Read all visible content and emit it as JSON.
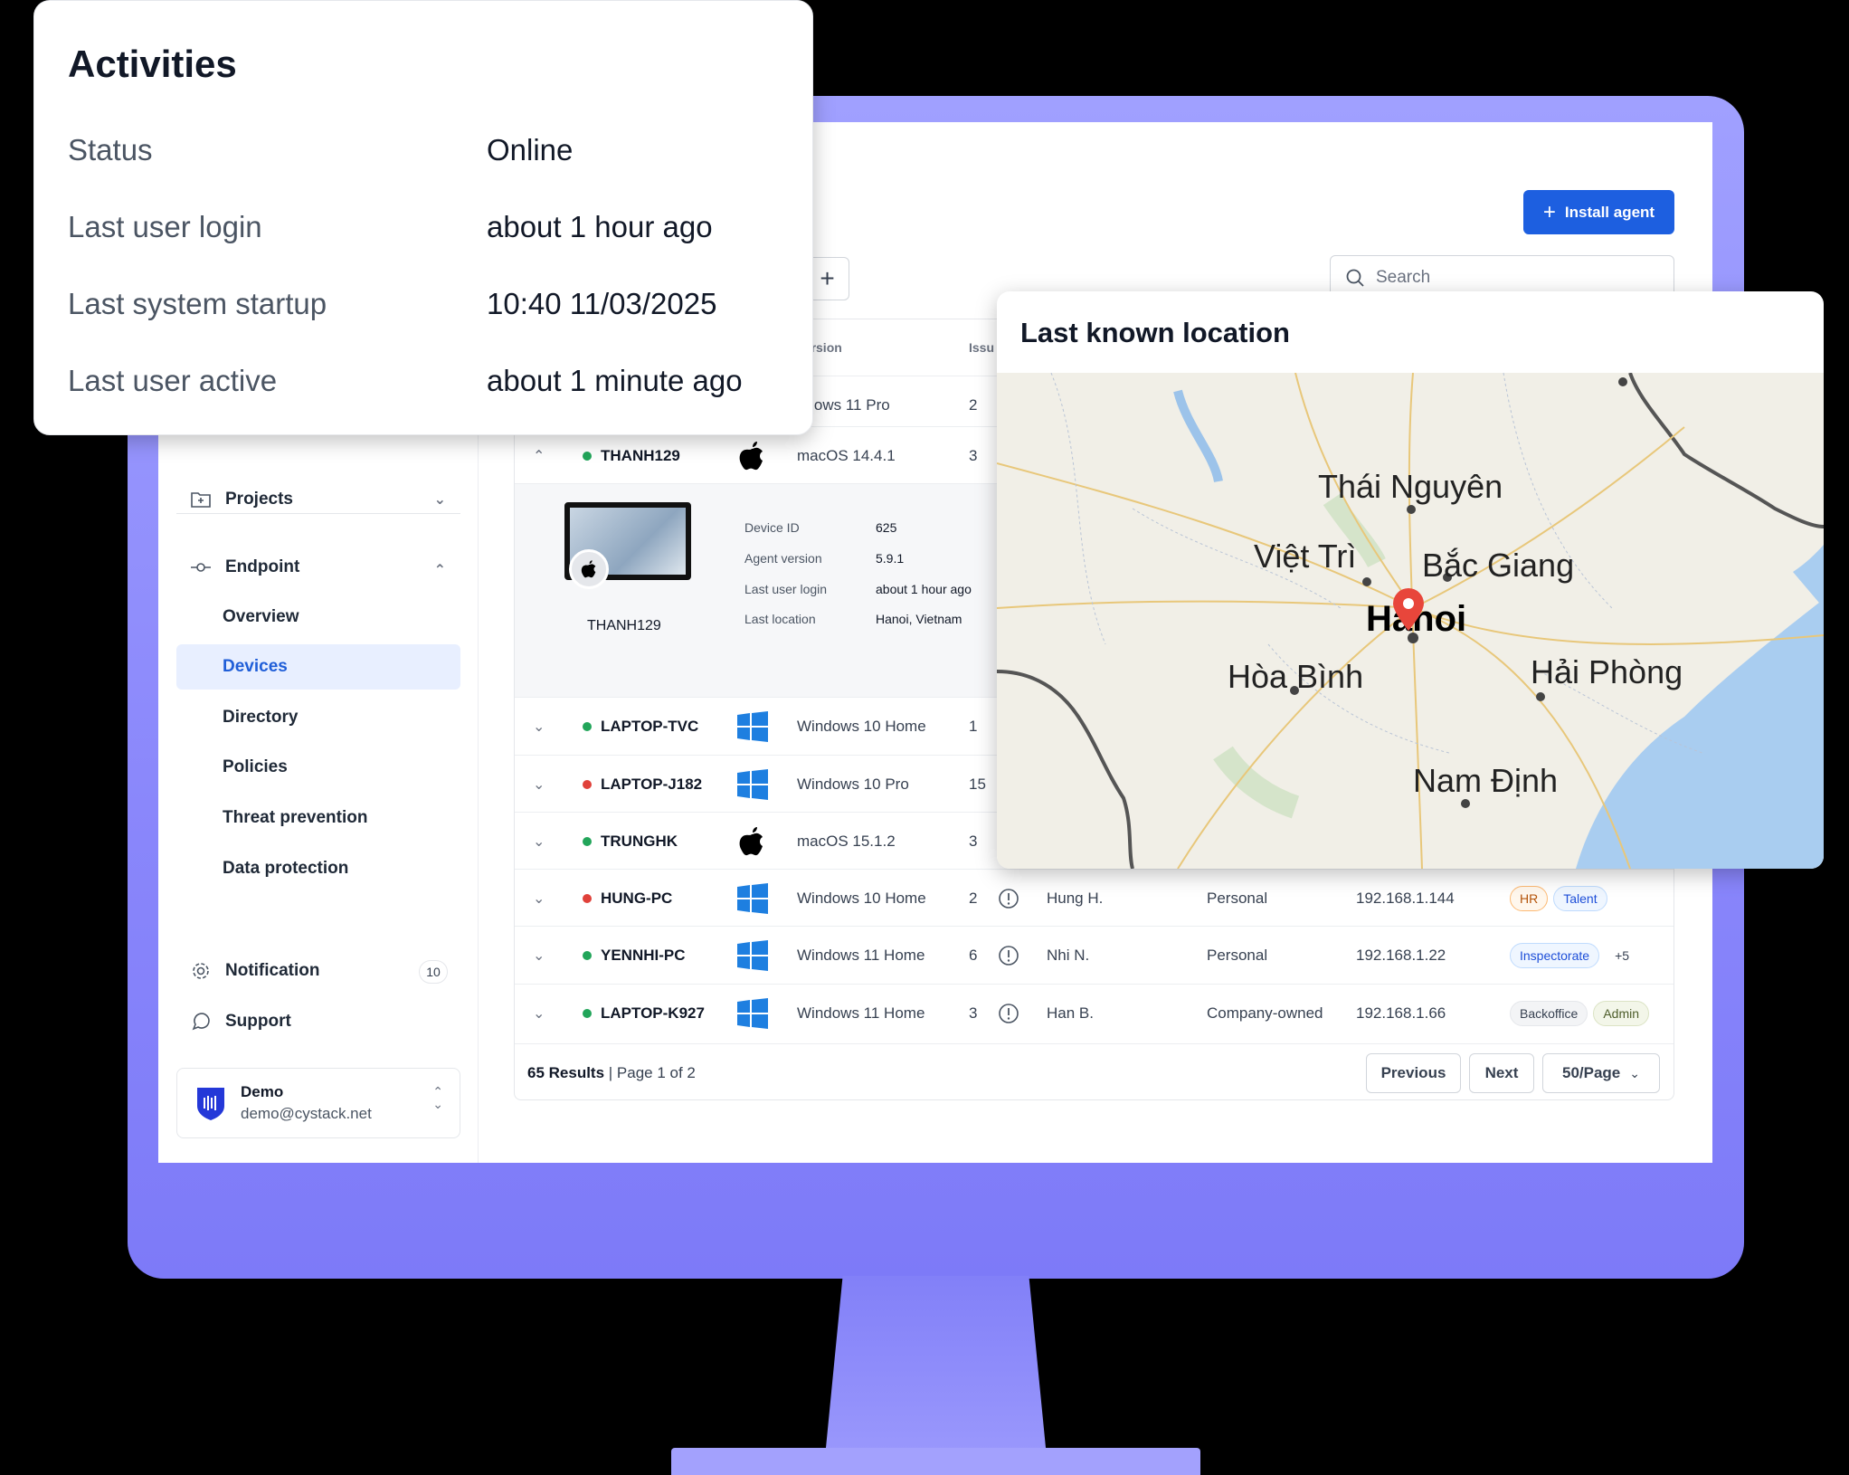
{
  "activities": {
    "title": "Activities",
    "rows": [
      {
        "label": "Status",
        "value": "Online"
      },
      {
        "label": "Last user login",
        "value": "about 1 hour ago"
      },
      {
        "label": "Last system startup",
        "value": "10:40 11/03/2025"
      },
      {
        "label": "Last user active",
        "value": "about 1 minute ago"
      }
    ]
  },
  "location": {
    "title": "Last known location",
    "places": [
      "Thái Nguyên",
      "Việt Trì",
      "Bắc Giang",
      "Hanoi",
      "Hòa Bình",
      "Hải Phòng",
      "Nam Định"
    ]
  },
  "header": {
    "install_label": "Install agent",
    "search_placeholder": "Search"
  },
  "sidebar": {
    "projects": "Projects",
    "endpoint": "Endpoint",
    "sub": [
      "Overview",
      "Devices",
      "Directory",
      "Policies",
      "Threat prevention",
      "Data protection"
    ],
    "notification": "Notification",
    "notification_count": "10",
    "support": "Support",
    "user_name": "Demo",
    "user_email": "demo@cystack.net"
  },
  "table": {
    "col_version": "version",
    "col_issues": "Issu",
    "top_row": {
      "os": "ndows 11 Pro",
      "issues": "2"
    },
    "expanded": {
      "device": "THANH129",
      "os": "macOS 14.4.1",
      "issues": "3",
      "status": "green"
    },
    "detail": {
      "device_caption": "THANH129",
      "fields": [
        {
          "label": "Device ID",
          "value": "625"
        },
        {
          "label": "Agent version",
          "value": "5.9.1"
        },
        {
          "label": "Last user login",
          "value": "about 1 hour ago"
        },
        {
          "label": "Last location",
          "value": "Hanoi, Vietnam"
        }
      ]
    },
    "rows": [
      {
        "device": "LAPTOP-TVC",
        "status": "green",
        "os_icon": "windows",
        "os": "Windows 10 Home",
        "issues": "1"
      },
      {
        "device": "LAPTOP-J182",
        "status": "red",
        "os_icon": "windows",
        "os": "Windows 10 Pro",
        "issues": "15"
      },
      {
        "device": "TRUNGHK",
        "status": "green",
        "os_icon": "apple",
        "os": "macOS 15.1.2",
        "issues": "3"
      },
      {
        "device": "HUNG-PC",
        "status": "red",
        "os_icon": "windows",
        "os": "Windows 10 Home",
        "issues": "2",
        "user": "Hung H.",
        "ownership": "Personal",
        "ip": "192.168.1.144",
        "tags": [
          {
            "text": "HR",
            "style": "orange"
          },
          {
            "text": "Talent",
            "style": "blue"
          }
        ]
      },
      {
        "device": "YENNHI-PC",
        "status": "green",
        "os_icon": "windows",
        "os": "Windows 11 Home",
        "issues": "6",
        "user": "Nhi N.",
        "ownership": "Personal",
        "ip": "192.168.1.22",
        "tags": [
          {
            "text": "Inspectorate",
            "style": "blue"
          },
          {
            "text": "+5",
            "style": "plain"
          }
        ]
      },
      {
        "device": "LAPTOP-K927",
        "status": "green",
        "os_icon": "windows",
        "os": "Windows 11 Home",
        "issues": "3",
        "user": "Han B.",
        "ownership": "Company-owned",
        "ip": "192.168.1.66",
        "tags": [
          {
            "text": "Backoffice",
            "style": "gray"
          },
          {
            "text": "Admin",
            "style": "green"
          }
        ]
      }
    ],
    "footer": {
      "results_count": "65 Results",
      "page_info": " | Page 1 of 2",
      "previous": "Previous",
      "next": "Next",
      "per_page": "50/Page"
    }
  },
  "colors": {
    "accent": "#1d5fe0",
    "online": "#22a55a",
    "offline": "#e0413a",
    "monitor": "#8f8cfb"
  }
}
